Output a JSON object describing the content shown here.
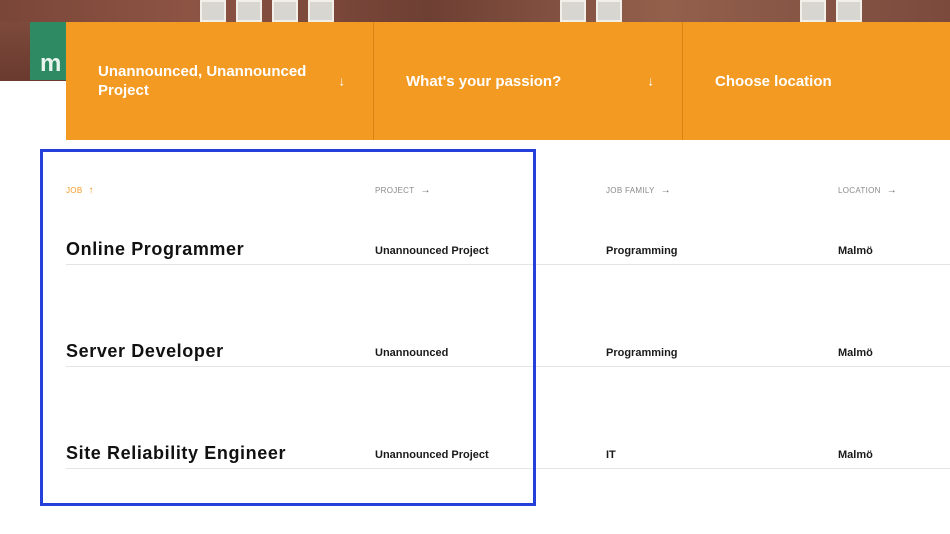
{
  "filters": [
    {
      "label": "Unannounced, Unannounced Project",
      "arrow": "↓"
    },
    {
      "label": "What's your passion?",
      "arrow": "↓"
    },
    {
      "label": "Choose location",
      "arrow": ""
    }
  ],
  "columns": {
    "job": {
      "label": "JOB",
      "arrow": "↑"
    },
    "project": {
      "label": "PROJECT",
      "arrow": "→"
    },
    "job_family": {
      "label": "JOB FAMILY",
      "arrow": "→"
    },
    "location": {
      "label": "LOCATION",
      "arrow": "→"
    }
  },
  "rows": [
    {
      "title": "Online Programmer",
      "project": "Unannounced Project",
      "family": "Programming",
      "location": "Malmö"
    },
    {
      "title": "Server Developer",
      "project": "Unannounced",
      "family": "Programming",
      "location": "Malmö"
    },
    {
      "title": "Site Reliability Engineer",
      "project": "Unannounced Project",
      "family": "IT",
      "location": "Malmö"
    }
  ],
  "colors": {
    "accent": "#f39a23",
    "highlight": "#2540d8"
  }
}
